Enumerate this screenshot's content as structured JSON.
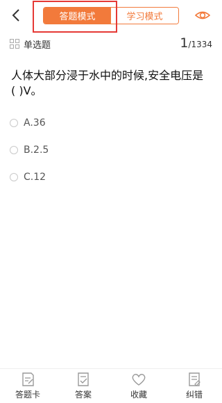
{
  "header": {
    "tabs": [
      {
        "label": "答题模式",
        "active": true
      },
      {
        "label": "学习模式",
        "active": false
      }
    ]
  },
  "question_info": {
    "type_label": "单选题",
    "current": "1",
    "total": "/1334"
  },
  "question": {
    "text_line1": "人体大部分浸于水中的时候,安全电压是",
    "text_line2": "(    )V。"
  },
  "options": [
    {
      "label": "A.36"
    },
    {
      "label": "B.2.5"
    },
    {
      "label": "C.12"
    }
  ],
  "bottom_bar": {
    "items": [
      {
        "label": "答题卡",
        "icon": "answer-sheet-icon"
      },
      {
        "label": "答案",
        "icon": "answer-icon"
      },
      {
        "label": "收藏",
        "icon": "heart-icon"
      },
      {
        "label": "纠错",
        "icon": "error-report-icon"
      }
    ]
  },
  "colors": {
    "accent": "#f27a3b",
    "highlight": "#e53935"
  }
}
